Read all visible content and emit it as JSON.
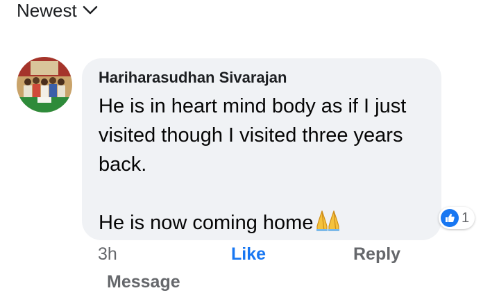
{
  "sort": {
    "label": "Newest",
    "icon": "chevron-down-icon"
  },
  "comment": {
    "author": "Hariharasudhan Sivarajan",
    "paragraph1": "He is in heart mind body as if I just visited though I visited three years back.",
    "paragraph2": "He is now coming home",
    "emoji": "folded-hands-icon",
    "reactions": {
      "icon": "like-reaction-icon",
      "count": "1",
      "color": "#1877f2"
    }
  },
  "actions": {
    "time": "3h",
    "like": "Like",
    "reply": "Reply",
    "message": "Message"
  },
  "colors": {
    "bubble": "#f0f2f5",
    "accent": "#1877f2",
    "secondary_text": "#65676b"
  }
}
